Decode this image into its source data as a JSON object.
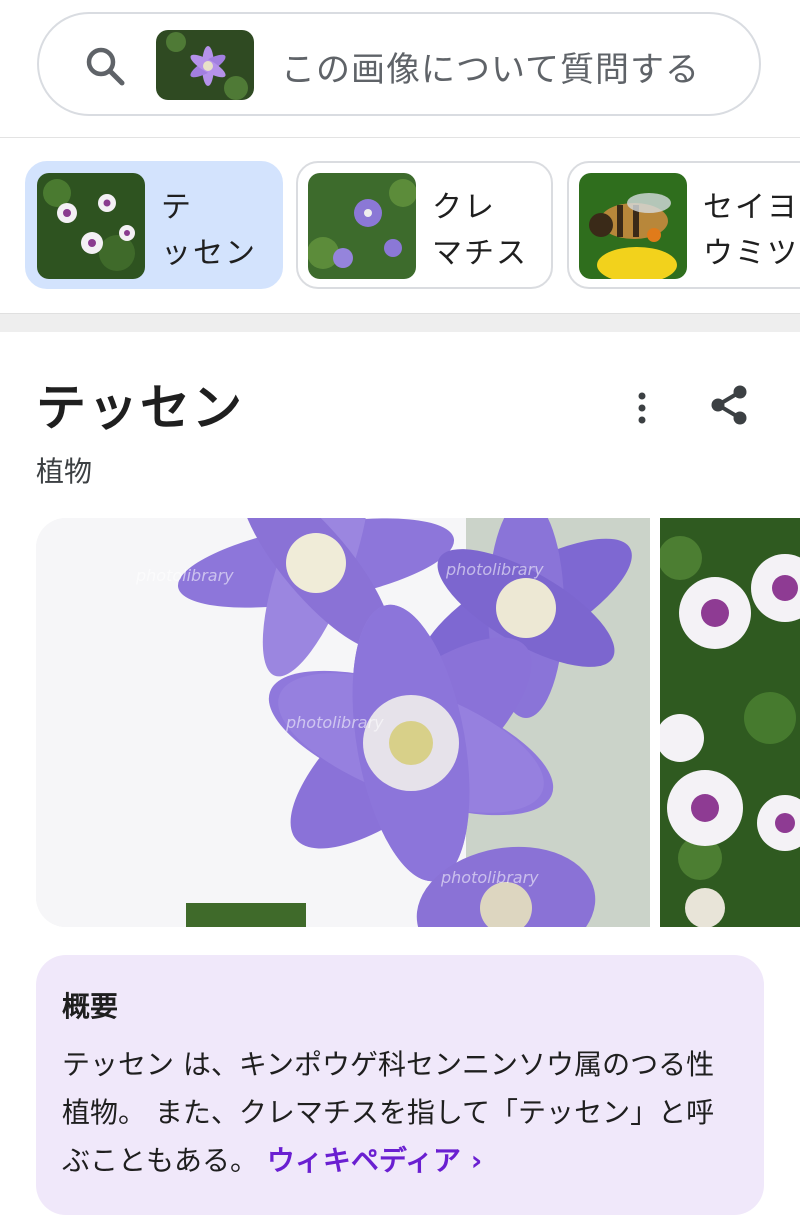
{
  "search": {
    "placeholder": "この画像について質問する"
  },
  "chips": [
    {
      "line1": "テ",
      "line2": "ッセン",
      "active": true
    },
    {
      "line1": "クレ",
      "line2": "マチス",
      "active": false
    },
    {
      "line1": "セイヨ",
      "line2": "ウミツ",
      "active": false
    }
  ],
  "entity": {
    "title": "テッセン",
    "subtitle": "植物"
  },
  "images": {
    "watermark": "photolibrary"
  },
  "overview": {
    "title": "概要",
    "text": "テッセン は、キンポウゲ科センニンソウ属のつる性植物。 また、クレマチスを指して「テッセン」と呼ぶこともある。",
    "link_label": "ウィキペディア ›"
  },
  "colors": {
    "accent_chip_bg": "#d3e3fd",
    "overview_bg": "#f0e8fa",
    "link": "#6a1fd1",
    "flower_purple": "#8a6ad8"
  },
  "icons": [
    "search-icon",
    "more-vert-icon",
    "share-icon"
  ]
}
